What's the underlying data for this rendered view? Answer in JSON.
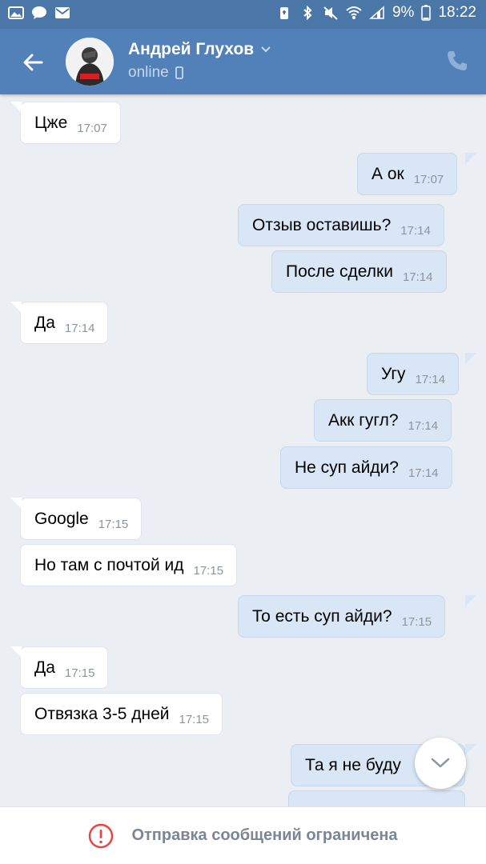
{
  "status_bar": {
    "battery_percent": "9%",
    "time": "18:22",
    "left_icons": [
      "gallery-icon",
      "chat-bubble-icon",
      "mail-icon"
    ],
    "right_icons": [
      "battery-saver-icon",
      "bluetooth-icon",
      "mute-icon",
      "wifi-icon",
      "signal-icon",
      "battery-icon"
    ]
  },
  "header": {
    "contact_name": "Андрей Глухов",
    "status": "online",
    "avatar_badge": "Supreme",
    "colors": {
      "header": "#5181b8",
      "statusbar": "#4a76a8"
    }
  },
  "messages": [
    {
      "dir": "in",
      "text": "Цже",
      "time": "17:07",
      "tail": true
    },
    {
      "dir": "out",
      "text": "А ок",
      "time": "17:07",
      "tail": true
    },
    {
      "dir": "out",
      "text": "Отзыв оставишь?",
      "time": "17:14",
      "tail": false
    },
    {
      "dir": "out",
      "text": "После сделки",
      "time": "17:14",
      "tail": false
    },
    {
      "dir": "in",
      "text": "Да",
      "time": "17:14",
      "tail": true
    },
    {
      "dir": "out",
      "text": "Угу",
      "time": "17:14",
      "tail": true
    },
    {
      "dir": "out",
      "text": "Акк гугл?",
      "time": "17:14",
      "tail": false
    },
    {
      "dir": "out",
      "text": "Не суп айди?",
      "time": "17:14",
      "tail": false
    },
    {
      "dir": "in",
      "text": "Google",
      "time": "17:15",
      "tail": true
    },
    {
      "dir": "in",
      "text": "Но там с почтой ид",
      "time": "17:15",
      "tail": false
    },
    {
      "dir": "out",
      "text": "То есть суп айди?",
      "time": "17:15",
      "tail": true
    },
    {
      "dir": "in",
      "text": "Да",
      "time": "17:15",
      "tail": true
    },
    {
      "dir": "in",
      "text": "Отвязка 3-5 дней",
      "time": "17:15",
      "tail": false
    },
    {
      "dir": "out",
      "text": "Та я не буду",
      "time": "",
      "tail": true
    },
    {
      "dir": "out",
      "text": "",
      "time": "",
      "tail": false
    }
  ],
  "bottom_bar": {
    "notice": "Отправка сообщений ограничена",
    "icon": "alert-circle-icon",
    "icon_color": "#e64646"
  }
}
